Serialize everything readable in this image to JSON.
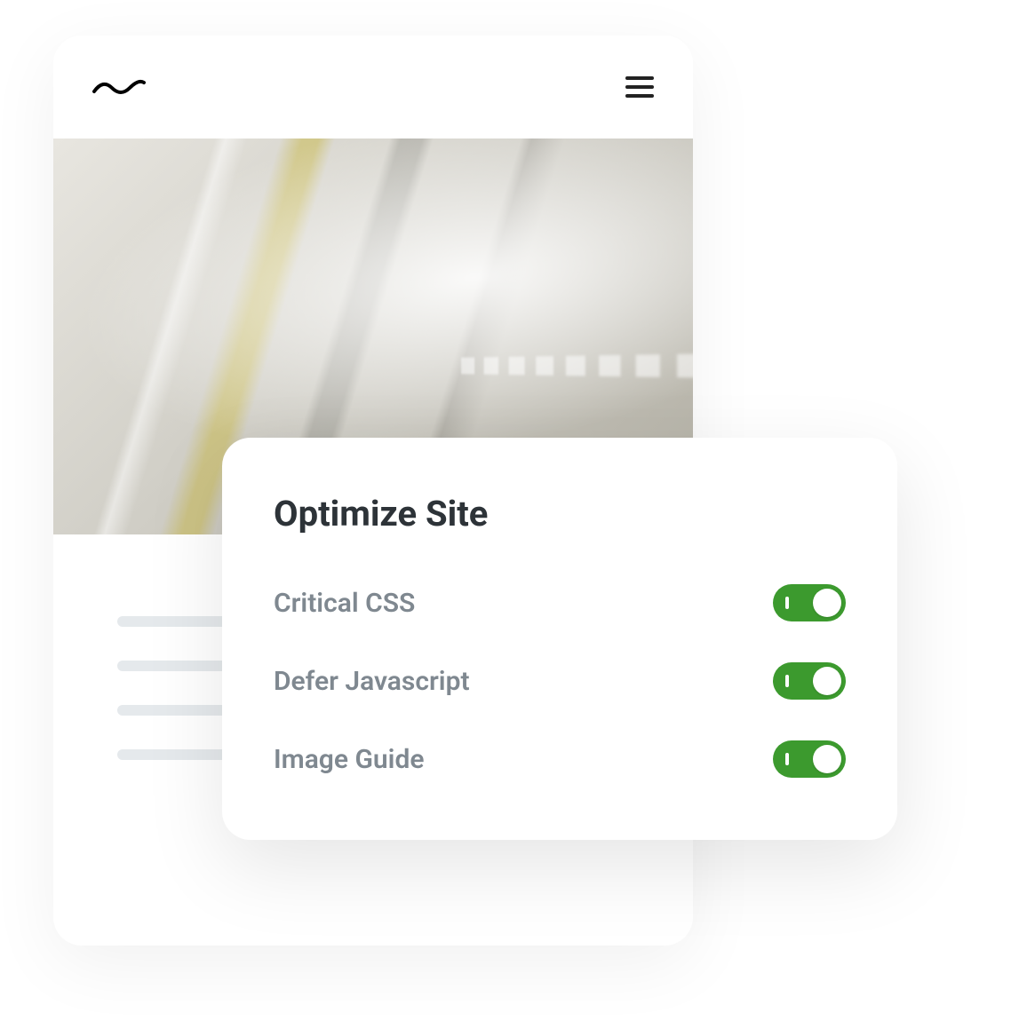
{
  "overlay": {
    "title": "Optimize Site",
    "options": [
      {
        "label": "Critical CSS",
        "enabled": true
      },
      {
        "label": "Defer Javascript",
        "enabled": true
      },
      {
        "label": "Image Guide",
        "enabled": true
      }
    ]
  },
  "colors": {
    "toggle_green": "#3c9a2e",
    "text_muted": "#7f8890",
    "text_heading": "#2d3338"
  }
}
